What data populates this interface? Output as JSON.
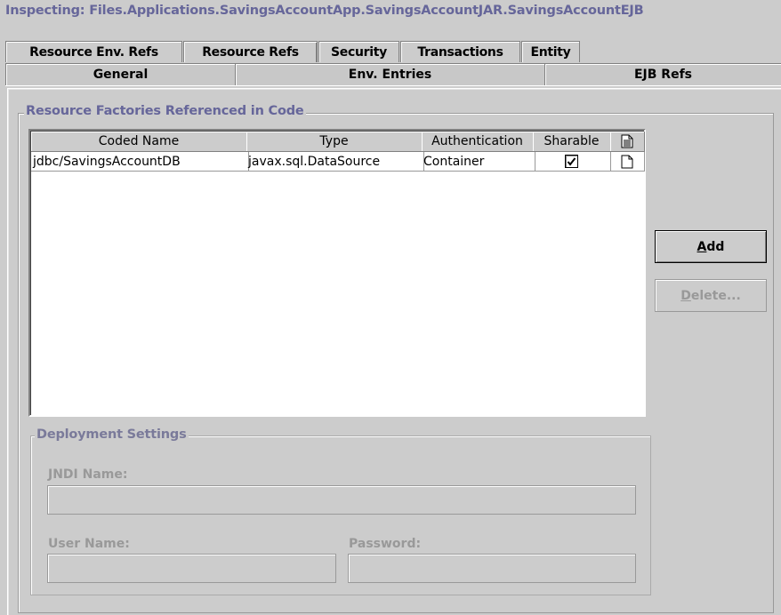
{
  "header": {
    "title": "Inspecting: Files.Applications.SavingsAccountApp.SavingsAccountJAR.SavingsAccountEJB"
  },
  "tabs_row1": [
    {
      "label": "Resource Env. Refs"
    },
    {
      "label": "Resource Refs"
    },
    {
      "label": "Security"
    },
    {
      "label": "Transactions"
    },
    {
      "label": "Entity"
    }
  ],
  "tabs_row2": [
    {
      "label": "General"
    },
    {
      "label": "Env. Entries"
    },
    {
      "label": "EJB Refs"
    }
  ],
  "resource_group": {
    "title": "Resource Factories Referenced in Code"
  },
  "table": {
    "columns": [
      "Coded Name",
      "Type",
      "Authentication",
      "Sharable",
      "doc-icon"
    ],
    "rows": [
      {
        "coded_name": "jdbc/SavingsAccountDB",
        "type": "javax.sql.DataSource",
        "authentication": "Container",
        "sharable": true
      }
    ]
  },
  "buttons": {
    "add_prefix": "",
    "add_mnemonic": "A",
    "add_rest": "dd",
    "delete_mnemonic": "D",
    "delete_rest": "elete..."
  },
  "deployment": {
    "title": "Deployment Settings",
    "jndi_label": "JNDI Name:",
    "jndi_value": "",
    "user_label": "User Name:",
    "user_value": "",
    "password_label": "Password:",
    "password_value": ""
  },
  "colors": {
    "title_text": "#66669a",
    "disabled_text": "#999999",
    "background": "#cccccc"
  }
}
